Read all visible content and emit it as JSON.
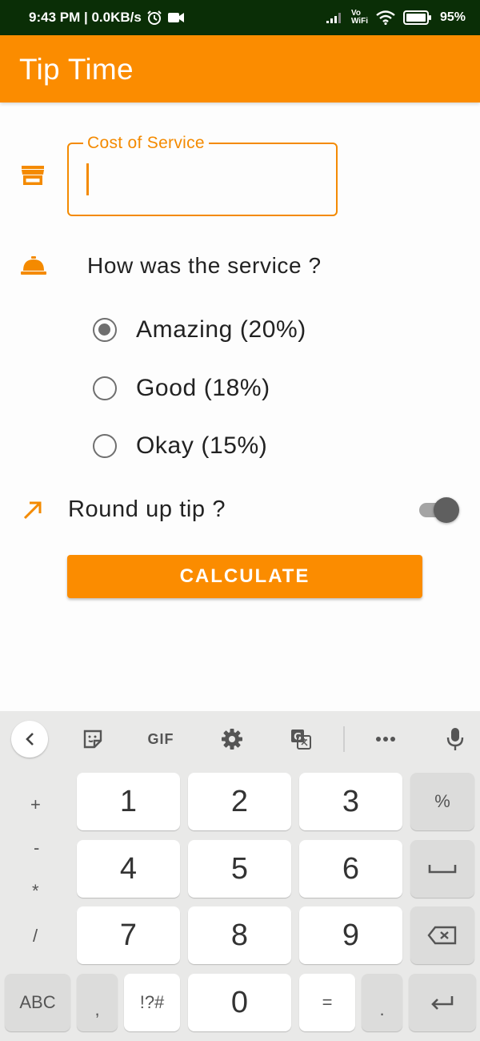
{
  "status": {
    "time_speed": "9:43 PM | 0.0KB/s",
    "battery": "95%",
    "vowifi": [
      "Vo",
      "WiFi"
    ],
    "icons": [
      "alarm-clock-icon",
      "video-camera-icon",
      "signal-icon",
      "wifi-icon",
      "battery-icon"
    ]
  },
  "app": {
    "title": "Tip Time",
    "accent": "#fb8c00"
  },
  "form": {
    "cost_label": "Cost of Service",
    "cost_value": "",
    "question": "How was the service ?",
    "options": [
      {
        "label": "Amazing (20%)",
        "selected": true
      },
      {
        "label": "Good (18%)",
        "selected": false
      },
      {
        "label": "Okay (15%)",
        "selected": false
      }
    ],
    "round_up_label": "Round up tip ?",
    "round_up_on": true,
    "calculate_label": "CALCULATE"
  },
  "keyboard": {
    "toolbar": [
      "back-icon",
      "sticker-icon",
      "GIF",
      "gear-icon",
      "translate-icon",
      "more-icon",
      "mic-icon"
    ],
    "gif_label": "GIF",
    "side_symbols": [
      "+",
      "-",
      "*",
      "/"
    ],
    "digits": [
      "1",
      "2",
      "3",
      "4",
      "5",
      "6",
      "7",
      "8",
      "9",
      "0"
    ],
    "percent": "%",
    "abc": "ABC",
    "comma": ",",
    "symbols": "!?#",
    "equals": "=",
    "period": "."
  }
}
